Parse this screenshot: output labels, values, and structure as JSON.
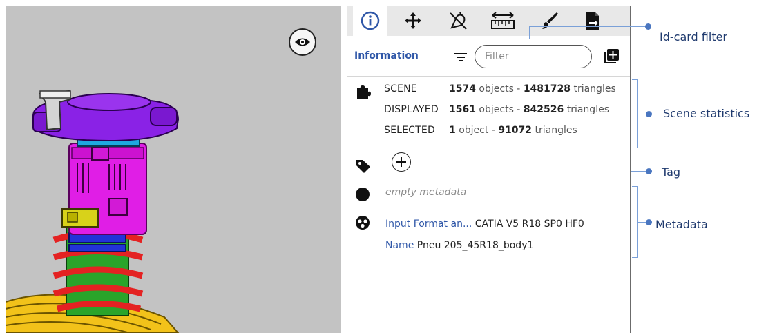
{
  "toolbar": {
    "tools": [
      {
        "icon": "info-icon",
        "active": true
      },
      {
        "icon": "move-icon"
      },
      {
        "icon": "hide-icon"
      },
      {
        "icon": "measure-icon"
      },
      {
        "icon": "brush-icon"
      },
      {
        "icon": "export-icon"
      }
    ]
  },
  "panel": {
    "title": "Information",
    "filter_placeholder": "Filter"
  },
  "stats": [
    {
      "key": "SCENE",
      "count": "1574",
      "count_unit": "objects",
      "sep": " - ",
      "tri": "1481728",
      "tri_unit": "triangles"
    },
    {
      "key": "DISPLAYED",
      "count": "1561",
      "count_unit": "objects",
      "sep": " - ",
      "tri": "842526",
      "tri_unit": "triangles"
    },
    {
      "key": "SELECTED",
      "count": "1",
      "count_unit": "object",
      "sep": " - ",
      "tri": "91072",
      "tri_unit": "triangles"
    }
  ],
  "metadata": {
    "empty_text": "empty metadata",
    "entries": [
      {
        "key": "Input Format an...",
        "value": "CATIA V5 R18 SP0 HF0"
      },
      {
        "key": "Name",
        "value": "Pneu 205_45R18_body1"
      }
    ]
  },
  "annotations": {
    "id_card_filter": "Id-card filter",
    "scene_statistics": "Scene statistics",
    "tag": "Tag",
    "metadata": "Metadata"
  },
  "colors": {
    "accent": "#2f57a8",
    "callout": "#4a76c0",
    "viewport_bg": "#c3c3c3"
  }
}
